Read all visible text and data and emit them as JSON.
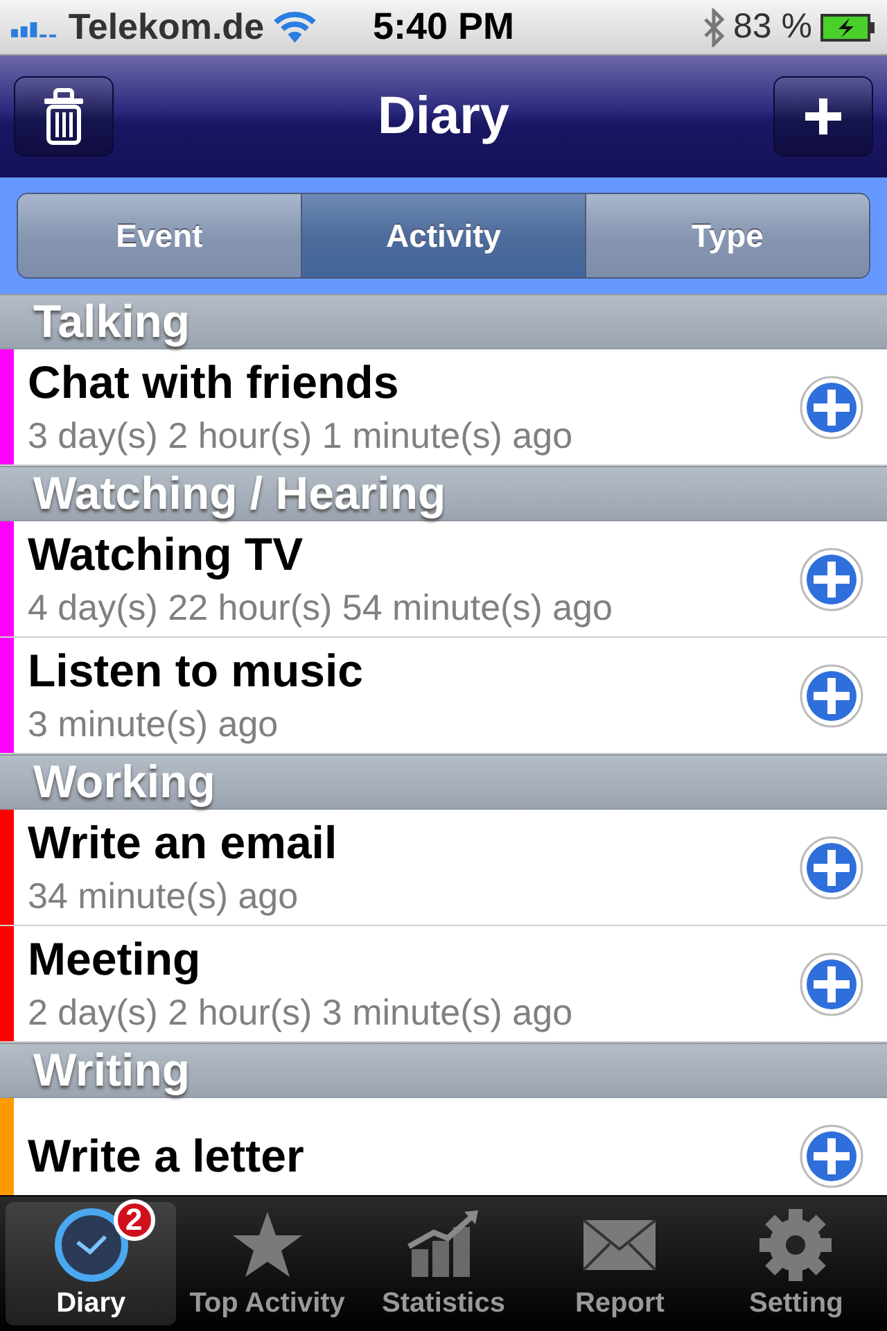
{
  "status_bar": {
    "carrier": "Telekom.de",
    "time": "5:40 PM",
    "battery": "83 %"
  },
  "nav_bar": {
    "title": "Diary"
  },
  "segments": [
    {
      "label": "Event",
      "selected": false
    },
    {
      "label": "Activity",
      "selected": true
    },
    {
      "label": "Type",
      "selected": false
    }
  ],
  "sections": [
    {
      "title": "Talking",
      "items": [
        {
          "title": "Chat with friends",
          "subtitle": "3 day(s) 2 hour(s) 1 minute(s) ago",
          "color": "#ff00ff"
        }
      ]
    },
    {
      "title": "Watching / Hearing",
      "items": [
        {
          "title": "Watching TV",
          "subtitle": "4 day(s) 22 hour(s) 54 minute(s) ago",
          "color": "#ff00ff"
        },
        {
          "title": "Listen to music",
          "subtitle": "3 minute(s) ago",
          "color": "#ff00ff"
        }
      ]
    },
    {
      "title": "Working",
      "items": [
        {
          "title": "Write an email",
          "subtitle": "34 minute(s) ago",
          "color": "#ff0000"
        },
        {
          "title": "Meeting",
          "subtitle": "2 day(s) 2 hour(s) 3 minute(s) ago",
          "color": "#ff0000"
        }
      ]
    },
    {
      "title": "Writing",
      "items": [
        {
          "title": "Write a letter",
          "color": "#ff9900"
        }
      ]
    }
  ],
  "tab_bar": [
    {
      "label": "Diary",
      "kind": "clock",
      "selected": true,
      "badge": "2"
    },
    {
      "label": "Top Activity",
      "kind": "star",
      "selected": false
    },
    {
      "label": "Statistics",
      "kind": "chart",
      "selected": false
    },
    {
      "label": "Report",
      "kind": "mail",
      "selected": false
    },
    {
      "label": "Setting",
      "kind": "gear",
      "selected": false
    }
  ]
}
